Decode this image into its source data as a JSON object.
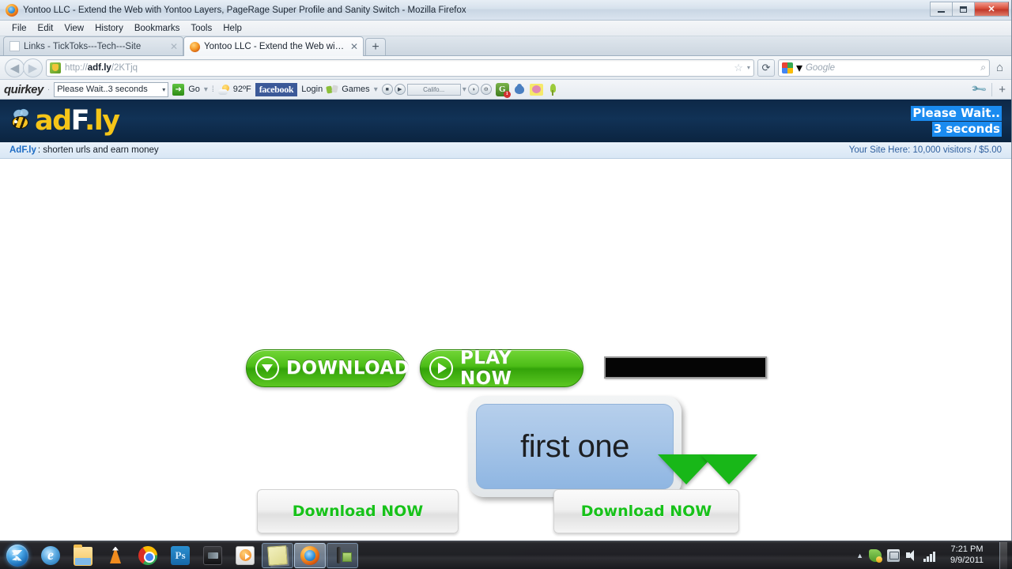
{
  "window": {
    "title": "Yontoo LLC - Extend the Web with Yontoo Layers, PageRage Super Profile and Sanity Switch - Mozilla Firefox",
    "icon": "firefox-icon",
    "controls": {
      "minimize": "minimize",
      "restore": "restore",
      "close": "✕"
    }
  },
  "menubar": {
    "items": [
      "File",
      "Edit",
      "View",
      "History",
      "Bookmarks",
      "Tools",
      "Help"
    ]
  },
  "tabs": [
    {
      "label": "Links - TickToks---Tech---Site",
      "active": false,
      "close": "✕"
    },
    {
      "label": "Yontoo LLC - Extend the Web with Yo...",
      "active": true,
      "close": "✕"
    }
  ],
  "newtab_label": "+",
  "navbar": {
    "back": "◀",
    "forward": "▶",
    "url_prefix": "http://",
    "url_domain": "adf.ly",
    "url_path": "/2KTjq",
    "bookmark_star": "☆",
    "dropdown_caret": "▾",
    "reload": "⟳",
    "search_engine": "Google",
    "search_placeholder": "Google",
    "search_magnifier": "⌕",
    "home": "⌂"
  },
  "addonbar": {
    "brand": "quirkey",
    "separator": "·",
    "search_value": "Please Wait..3 seconds",
    "search_caret": "▾",
    "go_label": "Go",
    "go_caret": "▾",
    "temperature": "92ºF",
    "facebook": "facebook",
    "login": "Login",
    "games": "Games",
    "games_caret": "▾",
    "station": "Califo...",
    "station_caret": "▾",
    "gmail_badge": "1",
    "gmail_letter": "G",
    "wrench": "wrench-icon",
    "plus": "+"
  },
  "adfly": {
    "logo_ad": "ad",
    "logo_f": "F",
    "logo_ly": ".ly",
    "countdown_line1": "Please Wait..",
    "countdown_line2": "3 seconds",
    "countdown_highlight_color": "#1a8bf0",
    "subbar_brand": "AdF.ly",
    "subbar_text": ": shorten urls and earn money",
    "subbar_right": "Your Site Here: 10,000 visitors / $5.00",
    "header_color": "#0d2847"
  },
  "ads": {
    "download_button": "DOWNLOAD",
    "playnow_button": "PLAY NOW",
    "black_banner": "",
    "first_one_label": "first one",
    "download_now_left": "Download NOW",
    "download_now_right": "Download NOW",
    "green_color": "#18c21a",
    "pill_green": "#4cbd17"
  },
  "taskbar": {
    "start": "start-orb",
    "pinned": [
      "internet-explorer",
      "windows-explorer",
      "vlc-media-player",
      "google-chrome",
      "photoshop",
      "dark-app",
      "media-player"
    ],
    "open_windows": [
      "sticky-notes",
      "mozilla-firefox",
      "tool-app"
    ],
    "tray": [
      "action-center",
      "network",
      "volume",
      "signal"
    ],
    "time": "7:21 PM",
    "date": "9/9/2011"
  }
}
